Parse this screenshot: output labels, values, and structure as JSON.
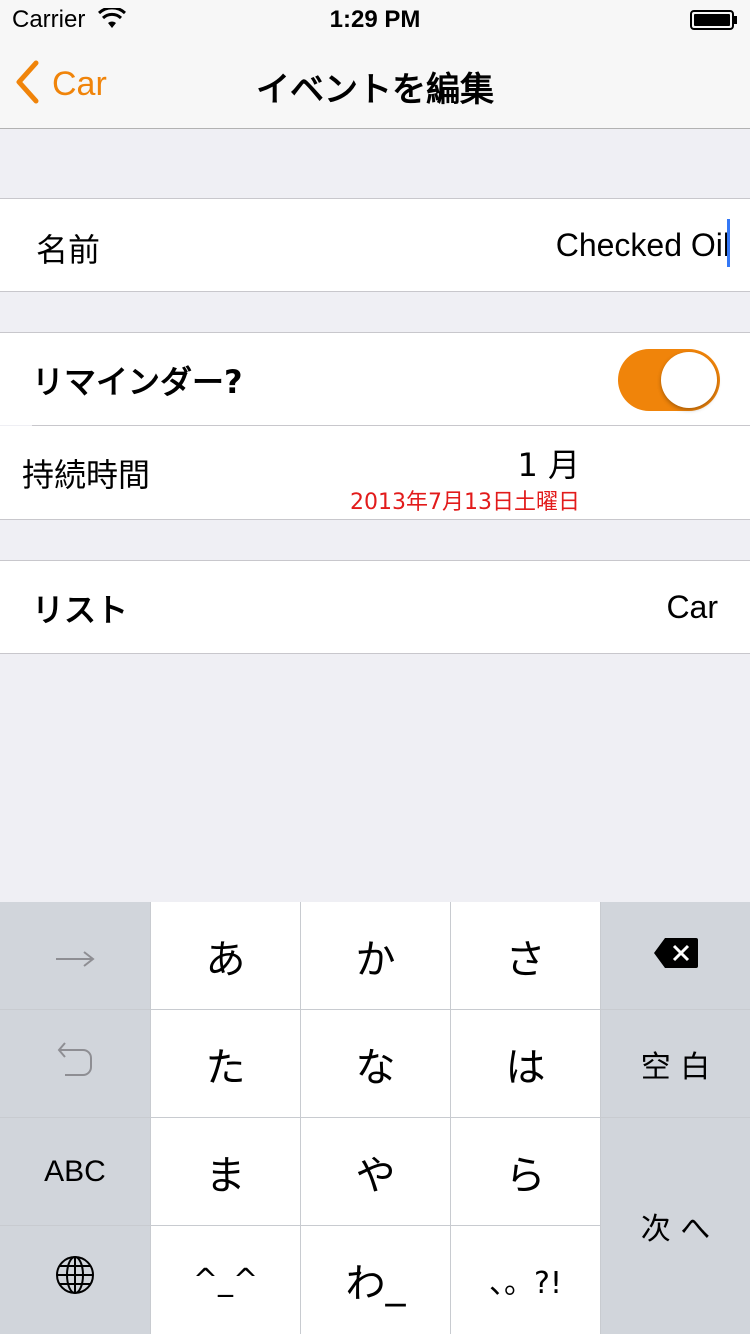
{
  "status": {
    "carrier": "Carrier",
    "time": "1:29 PM"
  },
  "nav": {
    "back_label": "Car",
    "title": "イベントを編集"
  },
  "form": {
    "name_label": "名前",
    "name_value": "Checked Oil",
    "reminder_label": "リマインダー?",
    "reminder_on": true,
    "duration_label": "持続時間",
    "duration_value": "1 月",
    "duration_date": "2013年7月13日土曜日",
    "list_label": "リスト",
    "list_value": "Car"
  },
  "keyboard": {
    "keys": {
      "a": "あ",
      "ka": "か",
      "sa": "さ",
      "ta": "た",
      "na": "な",
      "ha": "は",
      "ma": "ま",
      "ya": "や",
      "ra": "ら",
      "emoticon": "^_^",
      "wa": "わ_",
      "punct": "、。?!",
      "abc": "ABC",
      "space": "空 白",
      "next": "次 へ"
    }
  },
  "colors": {
    "accent": "#f0840a",
    "date_red": "#e21b1b",
    "caret": "#3478f6"
  },
  "icons": [
    "wifi-icon",
    "battery-icon",
    "chevron-left-icon",
    "arrow-right-icon",
    "backspace-icon",
    "undo-icon",
    "globe-icon"
  ]
}
